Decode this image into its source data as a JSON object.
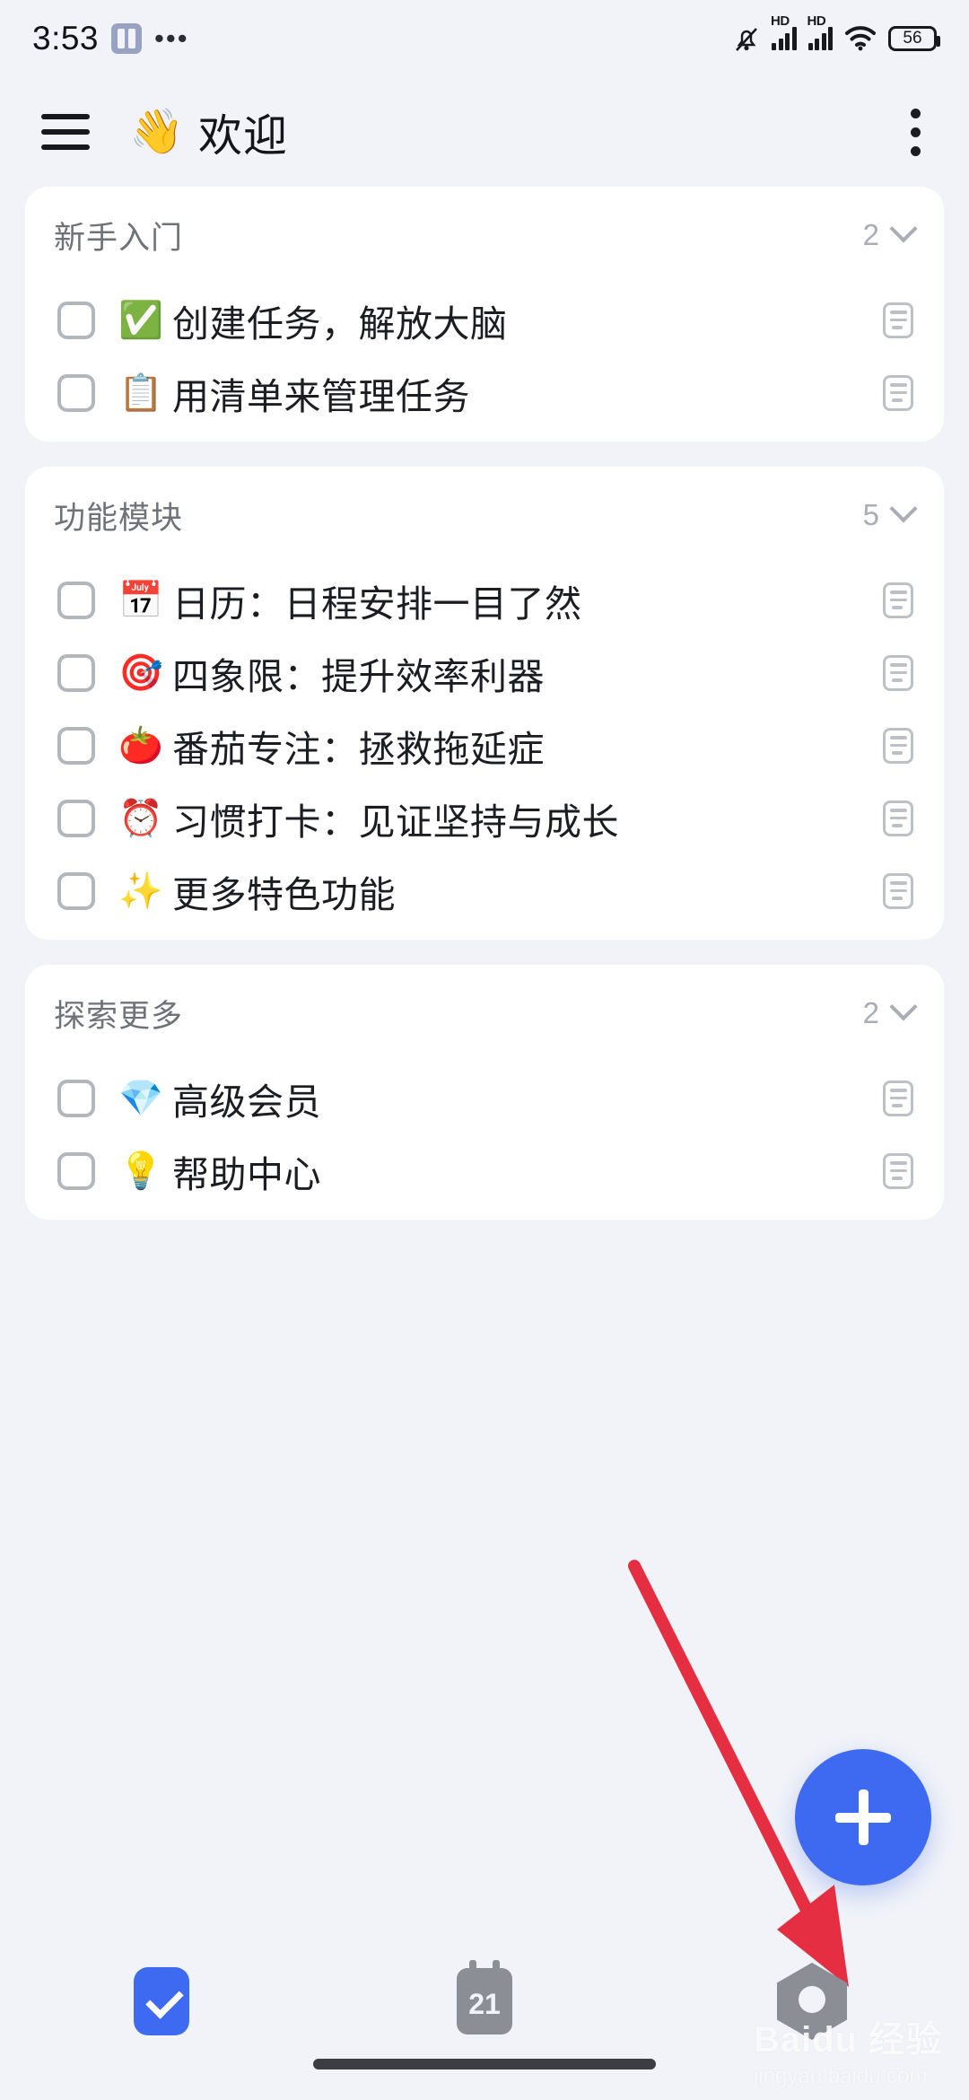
{
  "status_bar": {
    "time": "3:53",
    "app_icon": "app-grid-icon",
    "overflow": "•••",
    "mute_icon": "bell-muted-icon",
    "signal_1_label": "HD",
    "signal_2_label": "HD",
    "wifi_icon": "wifi-icon",
    "battery_level": "56"
  },
  "header": {
    "menu_icon": "hamburger-icon",
    "title_emoji": "👋",
    "title": "欢迎",
    "overflow_icon": "kebab-menu-icon"
  },
  "sections": [
    {
      "title": "新手入门",
      "count": "2",
      "items": [
        {
          "emoji": "✅",
          "label": "创建任务，解放大脑",
          "checked": false,
          "note_icon": "note-icon"
        },
        {
          "emoji": "📋",
          "label": "用清单来管理任务",
          "checked": false,
          "note_icon": "note-icon"
        }
      ]
    },
    {
      "title": "功能模块",
      "count": "5",
      "items": [
        {
          "emoji": "📅",
          "label": "日历：日程安排一目了然",
          "checked": false,
          "note_icon": "note-icon"
        },
        {
          "emoji": "🎯",
          "label": "四象限：提升效率利器",
          "checked": false,
          "note_icon": "note-icon"
        },
        {
          "emoji": "🍅",
          "label": "番茄专注：拯救拖延症",
          "checked": false,
          "note_icon": "note-icon"
        },
        {
          "emoji": "⏰",
          "label": "习惯打卡：见证坚持与成长",
          "checked": false,
          "note_icon": "note-icon"
        },
        {
          "emoji": "✨",
          "label": "更多特色功能",
          "checked": false,
          "note_icon": "note-icon"
        }
      ]
    },
    {
      "title": "探索更多",
      "count": "2",
      "items": [
        {
          "emoji": "💎",
          "label": "高级会员",
          "checked": false,
          "note_icon": "note-icon"
        },
        {
          "emoji": "💡",
          "label": "帮助中心",
          "checked": false,
          "note_icon": "note-icon"
        }
      ]
    }
  ],
  "fab": {
    "icon": "plus-icon"
  },
  "bottom_nav": {
    "items": [
      {
        "icon": "task-check-icon",
        "active": true
      },
      {
        "icon": "calendar-icon",
        "label": "21",
        "active": false
      },
      {
        "icon": "settings-hex-icon",
        "active": false
      }
    ]
  },
  "annotation": {
    "arrow_color": "#e62e42",
    "points_to": "settings-nav-item"
  },
  "watermark": {
    "main": "Baidu 经验",
    "sub": "jingyan.baidu.com"
  },
  "colors": {
    "background": "#f1f3f8",
    "card": "#ffffff",
    "accent": "#3d6af0",
    "muted_text": "#6e7279",
    "primary_text": "#1b1d23"
  }
}
